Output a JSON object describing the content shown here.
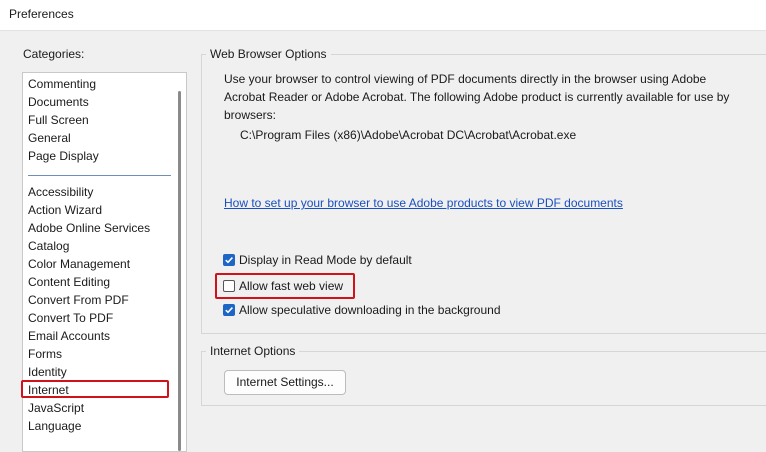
{
  "window": {
    "title": "Preferences"
  },
  "categories": {
    "label": "Categories:",
    "items": [
      "Commenting",
      "Documents",
      "Full Screen",
      "General",
      "Page Display",
      "Accessibility",
      "Action Wizard",
      "Adobe Online Services",
      "Catalog",
      "Color Management",
      "Content Editing",
      "Convert From PDF",
      "Convert To PDF",
      "Email Accounts",
      "Forms",
      "Identity",
      "Internet",
      "JavaScript",
      "Language"
    ],
    "selected": "Internet"
  },
  "web_browser_options": {
    "title": "Web Browser Options",
    "description": "Use your browser to control viewing of PDF documents directly in the browser using Adobe Acrobat Reader or Adobe Acrobat. The following Adobe product is currently available for use by browsers:",
    "product_path": "C:\\Program Files (x86)\\Adobe\\Acrobat DC\\Acrobat\\Acrobat.exe",
    "help_link": "How to set up your browser to use Adobe products to view PDF documents",
    "checkboxes": [
      {
        "label": "Display in Read Mode by default",
        "checked": true
      },
      {
        "label": "Allow fast web view",
        "checked": false
      },
      {
        "label": "Allow speculative downloading in the background",
        "checked": true
      }
    ]
  },
  "internet_options": {
    "title": "Internet Options",
    "button": "Internet Settings..."
  },
  "colors": {
    "highlight": "#d0121b",
    "checkbox_accent": "#1e66c5",
    "link": "#1a4fbf"
  }
}
